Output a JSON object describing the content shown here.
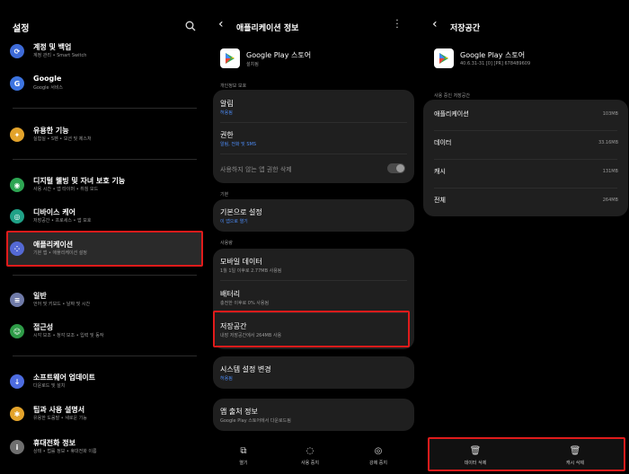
{
  "left": {
    "title": "설정",
    "items": [
      {
        "title": "계정 및 백업",
        "subtitle": "계정 관리 • Smart Switch",
        "icon": "sync-icon",
        "color": "#3e6bd8"
      },
      {
        "title": "Google",
        "subtitle": "Google 서비스",
        "icon": "google-icon",
        "color": "#3d74e0"
      },
      {
        "title": "유용한 기능",
        "subtitle": "실험실 • S펜 • 모션 및 제스처",
        "icon": "star-icon",
        "color": "#e3a32b"
      },
      {
        "title": "디지털 웰빙 및 자녀 보호 기능",
        "subtitle": "사용 시간 • 앱 타이머 • 취침 모드",
        "icon": "wellbeing-icon",
        "color": "#2da552"
      },
      {
        "title": "디바이스 케어",
        "subtitle": "저장공간 • 프로세스 • 앱 보호",
        "icon": "device-care-icon",
        "color": "#20a187"
      },
      {
        "title": "애플리케이션",
        "subtitle": "기본 앱 • 애플리케이션 설정",
        "icon": "apps-icon",
        "color": "#5469d4"
      },
      {
        "title": "일반",
        "subtitle": "언어 및 키보드 • 날짜 및 시간",
        "icon": "general-icon",
        "color": "#6f7aa8"
      },
      {
        "title": "접근성",
        "subtitle": "시각 보조 • 청각 보조 • 입력 및 동작",
        "icon": "accessibility-icon",
        "color": "#2e9b47"
      },
      {
        "title": "소프트웨어 업데이트",
        "subtitle": "다운로드 및 설치",
        "icon": "update-icon",
        "color": "#4d6ce0"
      },
      {
        "title": "팁과 사용 설명서",
        "subtitle": "유용한 도움말 • 새로운 기능",
        "icon": "tips-icon",
        "color": "#e3a32b"
      },
      {
        "title": "휴대전화 정보",
        "subtitle": "상태 • 법률 정보 • 휴대전화 이름",
        "icon": "phone-info-icon",
        "color": "#6f6f6f"
      }
    ]
  },
  "middle": {
    "title": "애플리케이션 정보",
    "app_name": "Google Play 스토어",
    "app_status": "설치됨",
    "section_privacy": "개인정보 보호",
    "notifications_title": "알림",
    "notifications_value": "허용됨",
    "permissions_title": "권한",
    "permissions_value": "알림, 전화 및 SMS",
    "remove_permissions": "사용하지 않는 앱 권한 삭제",
    "section_default": "기본",
    "default_title": "기본으로 설정",
    "default_value": "이 앱으로 열기",
    "section_usage": "사용량",
    "mobile_data_title": "모바일 데이터",
    "mobile_data_value": "1월 1일 이후로 2.77MB 사용됨",
    "battery_title": "배터리",
    "battery_value": "충전한 이후로 0% 사용됨",
    "storage_title": "저장공간",
    "storage_value": "내장 저장공간에서 264MB 사용",
    "system_settings_title": "시스템 설정 변경",
    "system_settings_value": "허용됨",
    "app_source_title": "앱 출처 정보",
    "app_source_value": "Google Play 스토어에서 다운로드됨",
    "bottom": {
      "open": "열기",
      "disable": "사용 중지",
      "force_stop": "강제 중지"
    }
  },
  "right": {
    "title": "저장공간",
    "app_name": "Google Play 스토어",
    "version": "40.6.31-31 [0] [PR] 678489609",
    "section": "사용 중인 저장공간",
    "rows": [
      {
        "label": "애플리케이션",
        "value": "103MB"
      },
      {
        "label": "데이터",
        "value": "33.16MB"
      },
      {
        "label": "캐시",
        "value": "131MB"
      },
      {
        "label": "전체",
        "value": "264MB"
      }
    ],
    "clear_data": "데이터 삭제",
    "clear_cache": "캐시 삭제"
  }
}
